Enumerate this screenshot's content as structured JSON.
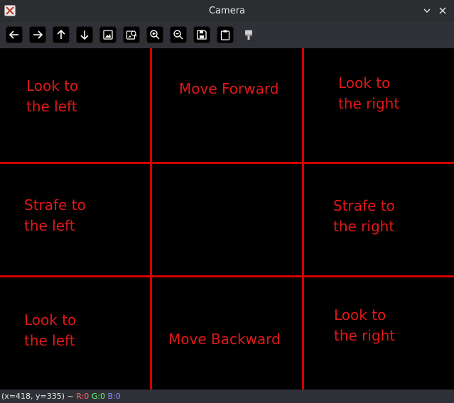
{
  "window": {
    "title": "Camera",
    "icons": {
      "app": "opencv-logo-icon",
      "minimize": "chevron-down-icon",
      "close": "close-icon"
    }
  },
  "toolbar": {
    "buttons": [
      {
        "name": "pan-left-button",
        "icon": "arrow-left-icon"
      },
      {
        "name": "pan-right-button",
        "icon": "arrow-right-icon"
      },
      {
        "name": "pan-up-button",
        "icon": "arrow-up-icon"
      },
      {
        "name": "pan-down-button",
        "icon": "arrow-down-icon"
      },
      {
        "name": "zoom-original-button",
        "icon": "image-icon"
      },
      {
        "name": "zoom-fit-button",
        "icon": "image-search-icon"
      },
      {
        "name": "zoom-in-button",
        "icon": "zoom-in-icon"
      },
      {
        "name": "zoom-out-button",
        "icon": "zoom-out-icon"
      },
      {
        "name": "save-image-button",
        "icon": "save-icon"
      },
      {
        "name": "copy-to-clipboard-button",
        "icon": "clipboard-icon"
      },
      {
        "name": "properties-button",
        "icon": "paint-brush-icon"
      }
    ]
  },
  "canvas": {
    "line_color": "#d40000",
    "text_color": "#e01818",
    "cells": {
      "top_left": "Look to\nthe left",
      "top_center": "Move Forward",
      "top_right": "Look to\nthe right",
      "middle_left": "Strafe to\nthe left",
      "middle_right": "Strafe to\nthe right",
      "bottom_left": "Look to\nthe left",
      "bottom_center": "Move Backward",
      "bottom_right": "Look to\nthe right"
    }
  },
  "status": {
    "coords": "(x=418, y=335) ~ ",
    "r": "R:0",
    "g": "G:0",
    "b": "B:0",
    "colors": {
      "r": "#ff6b6b",
      "g": "#6bff6b",
      "b": "#8c8cff"
    }
  }
}
